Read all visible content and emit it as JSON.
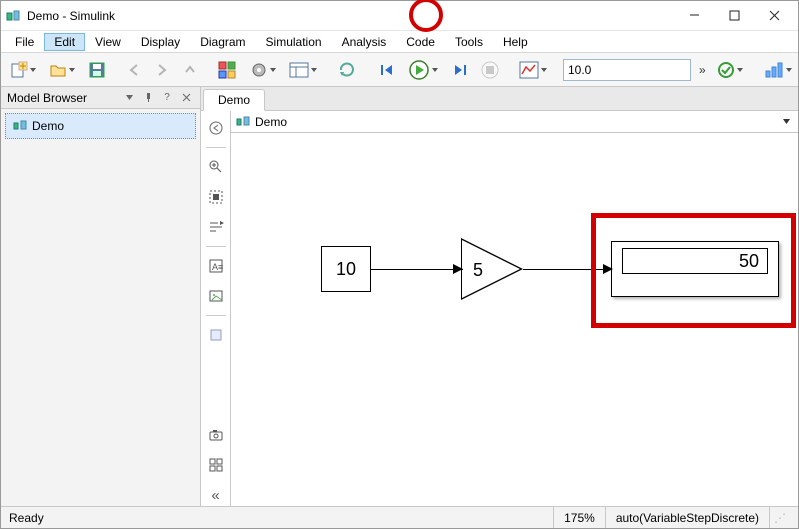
{
  "window": {
    "title": "Demo - Simulink"
  },
  "menu": [
    "File",
    "Edit",
    "View",
    "Display",
    "Diagram",
    "Simulation",
    "Analysis",
    "Code",
    "Tools",
    "Help"
  ],
  "menu_selected_index": 1,
  "toolbar": {
    "stop_time": "10.0"
  },
  "sidebar": {
    "title": "Model Browser",
    "items": [
      {
        "label": "Demo"
      }
    ]
  },
  "tab": {
    "label": "Demo"
  },
  "crumb": {
    "label": "Demo"
  },
  "blocks": {
    "constant": {
      "value": "10"
    },
    "gain": {
      "value": "5"
    },
    "display": {
      "value": "50"
    }
  },
  "status": {
    "left": "Ready",
    "zoom": "175%",
    "solver": "auto(VariableStepDiscrete)"
  },
  "chart_data": {
    "type": "block-diagram",
    "blocks": [
      {
        "id": "c",
        "type": "Constant",
        "value": 10
      },
      {
        "id": "g",
        "type": "Gain",
        "value": 5
      },
      {
        "id": "d",
        "type": "Display",
        "value": 50
      }
    ],
    "wires": [
      [
        "c",
        "g"
      ],
      [
        "g",
        "d"
      ]
    ]
  }
}
